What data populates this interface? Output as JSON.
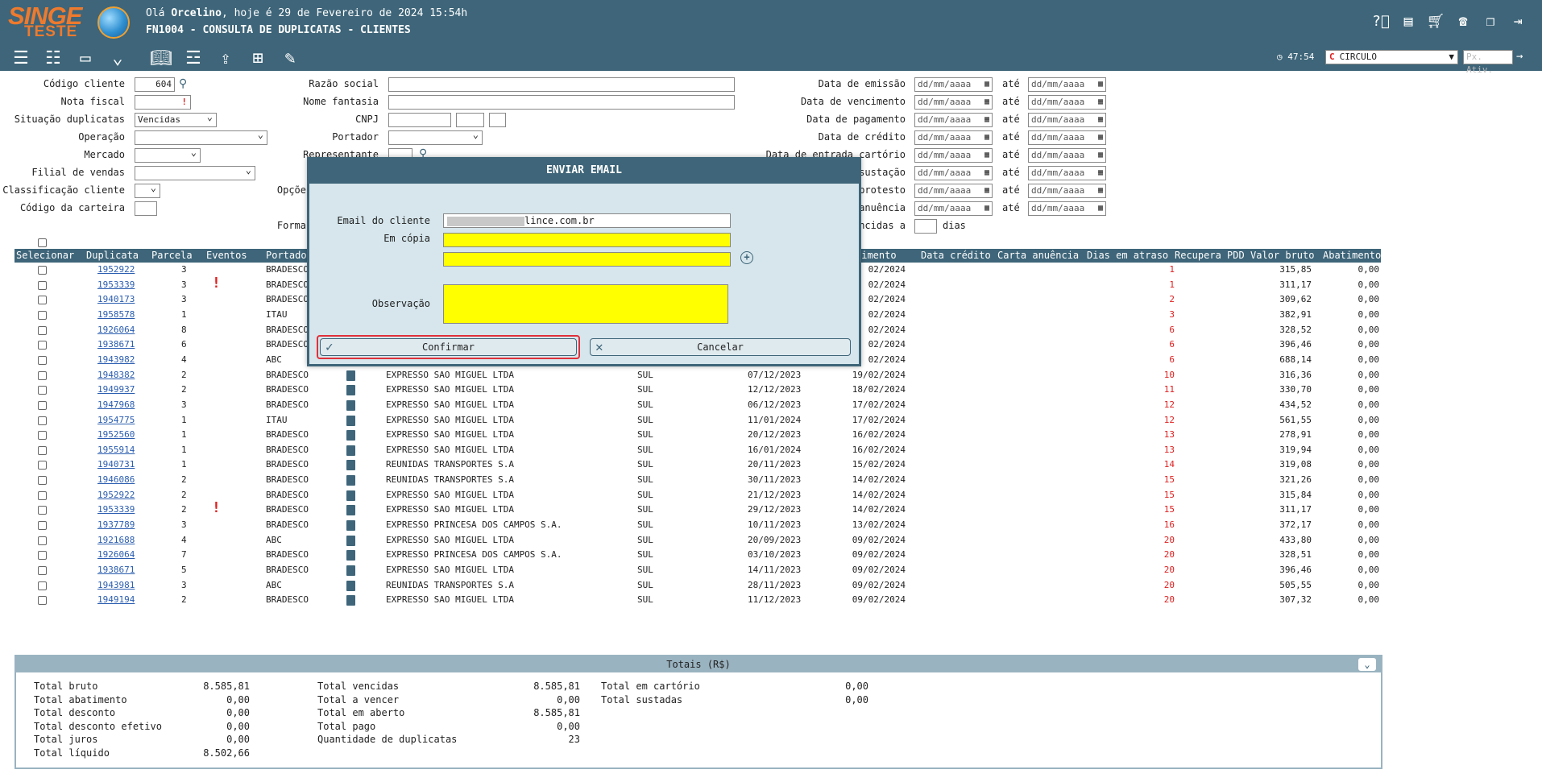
{
  "header": {
    "logo_top": "SINGE",
    "logo_bottom": "TESTE",
    "greeting_prefix": "Olá ",
    "greeting_user": "Orcelino",
    "greeting_suffix": ", hoje é 29 de Fevereiro de 2024 15:54h",
    "screen_title": "FN1004 - CONSULTA DE DUPLICATAS - CLIENTES",
    "icons": [
      "help-icon",
      "document-icon",
      "cart-icon",
      "phone-icon",
      "windows-icon",
      "logout-icon"
    ]
  },
  "toolbar": {
    "icons": [
      "list-icon",
      "checklist-icon",
      "card-list-icon",
      "expand-icon",
      "book-icon",
      "sliders-icon",
      "upload-icon",
      "grid-icon",
      "edit-document-icon"
    ],
    "timer": "47:54",
    "company": "CIRCULO",
    "px_ativ_placeholder": "Px. Ativ."
  },
  "filters": {
    "codigo_cliente_label": "Código cliente",
    "codigo_cliente_value": "604",
    "nota_fiscal_label": "Nota fiscal",
    "situacao_label": "Situação duplicatas",
    "situacao_value": "Vencidas",
    "operacao_label": "Operação",
    "mercado_label": "Mercado",
    "filial_label": "Filial de vendas",
    "classificacao_label": "Classificação cliente",
    "carteira_label": "Código da carteira",
    "razao_label": "Razão social",
    "fantasia_label": "Nome fantasia",
    "cnpj_label": "CNPJ",
    "portador_label": "Portador",
    "representante_label": "Representante",
    "opcoes_label": "Opçõe",
    "forma_label": "Forma",
    "emissao_label": "Data de emissão",
    "vencimento_label": "Data de vencimento",
    "pagamento_label": "Data de pagamento",
    "credito_label": "Data de crédito",
    "cartorio_label": "Data de entrada cartório",
    "sustacao_label": "sustação",
    "protesto_label": "protesto",
    "anuencia_label": "anuência",
    "vencidas_a_label": "ncidas a",
    "dias_label": "dias",
    "date_placeholder": "dd/mm/aaaa",
    "ate": "até"
  },
  "table": {
    "headers": [
      "Selecionar",
      "Duplicata",
      "Parcela",
      "Eventos",
      "Portado",
      "cimento",
      "Data crédito",
      "Carta anuência",
      "Dias em atraso",
      "Recupera PDD",
      "Valor bruto",
      "Abatimento"
    ],
    "rows": [
      {
        "dup": "1952922",
        "parc": "3",
        "ev": false,
        "port": "BRADESCO",
        "doc": false,
        "razao": "",
        "reg": "",
        "emis": "",
        "venc": "02/2024",
        "dias": "1",
        "bruto": "315,85",
        "abat": "0,00"
      },
      {
        "dup": "1953339",
        "parc": "3",
        "ev": true,
        "port": "BRADESCO",
        "doc": false,
        "razao": "",
        "reg": "",
        "emis": "",
        "venc": "02/2024",
        "dias": "1",
        "bruto": "311,17",
        "abat": "0,00"
      },
      {
        "dup": "1940173",
        "parc": "3",
        "ev": false,
        "port": "BRADESCO",
        "doc": false,
        "razao": "",
        "reg": "",
        "emis": "",
        "venc": "02/2024",
        "dias": "2",
        "bruto": "309,62",
        "abat": "0,00"
      },
      {
        "dup": "1958578",
        "parc": "1",
        "ev": false,
        "port": "ITAU",
        "doc": false,
        "razao": "",
        "reg": "",
        "emis": "",
        "venc": "02/2024",
        "dias": "3",
        "bruto": "382,91",
        "abat": "0,00"
      },
      {
        "dup": "1926064",
        "parc": "8",
        "ev": false,
        "port": "BRADESCO",
        "doc": false,
        "razao": "",
        "reg": "",
        "emis": "",
        "venc": "02/2024",
        "dias": "6",
        "bruto": "328,52",
        "abat": "0,00"
      },
      {
        "dup": "1938671",
        "parc": "6",
        "ev": false,
        "port": "BRADESCO",
        "doc": false,
        "razao": "",
        "reg": "",
        "emis": "",
        "venc": "02/2024",
        "dias": "6",
        "bruto": "396,46",
        "abat": "0,00"
      },
      {
        "dup": "1943982",
        "parc": "4",
        "ev": false,
        "port": "ABC",
        "doc": false,
        "razao": "",
        "reg": "",
        "emis": "",
        "venc": "02/2024",
        "dias": "6",
        "bruto": "688,14",
        "abat": "0,00"
      },
      {
        "dup": "1948382",
        "parc": "2",
        "ev": false,
        "port": "BRADESCO",
        "doc": true,
        "razao": "EXPRESSO SAO MIGUEL LTDA",
        "reg": "SUL",
        "emis": "07/12/2023",
        "venc": "19/02/2024",
        "dias": "10",
        "bruto": "316,36",
        "abat": "0,00"
      },
      {
        "dup": "1949937",
        "parc": "2",
        "ev": false,
        "port": "BRADESCO",
        "doc": true,
        "razao": "EXPRESSO SAO MIGUEL LTDA",
        "reg": "SUL",
        "emis": "12/12/2023",
        "venc": "18/02/2024",
        "dias": "11",
        "bruto": "330,70",
        "abat": "0,00"
      },
      {
        "dup": "1947968",
        "parc": "3",
        "ev": false,
        "port": "BRADESCO",
        "doc": true,
        "razao": "EXPRESSO SAO MIGUEL LTDA",
        "reg": "SUL",
        "emis": "06/12/2023",
        "venc": "17/02/2024",
        "dias": "12",
        "bruto": "434,52",
        "abat": "0,00"
      },
      {
        "dup": "1954775",
        "parc": "1",
        "ev": false,
        "port": "ITAU",
        "doc": true,
        "razao": "EXPRESSO SAO MIGUEL LTDA",
        "reg": "SUL",
        "emis": "11/01/2024",
        "venc": "17/02/2024",
        "dias": "12",
        "bruto": "561,55",
        "abat": "0,00"
      },
      {
        "dup": "1952560",
        "parc": "1",
        "ev": false,
        "port": "BRADESCO",
        "doc": true,
        "razao": "EXPRESSO SAO MIGUEL LTDA",
        "reg": "SUL",
        "emis": "20/12/2023",
        "venc": "16/02/2024",
        "dias": "13",
        "bruto": "278,91",
        "abat": "0,00"
      },
      {
        "dup": "1955914",
        "parc": "1",
        "ev": false,
        "port": "BRADESCO",
        "doc": true,
        "razao": "EXPRESSO SAO MIGUEL LTDA",
        "reg": "SUL",
        "emis": "16/01/2024",
        "venc": "16/02/2024",
        "dias": "13",
        "bruto": "319,94",
        "abat": "0,00"
      },
      {
        "dup": "1940731",
        "parc": "1",
        "ev": false,
        "port": "BRADESCO",
        "doc": true,
        "razao": "REUNIDAS TRANSPORTES S.A",
        "reg": "SUL",
        "emis": "20/11/2023",
        "venc": "15/02/2024",
        "dias": "14",
        "bruto": "319,08",
        "abat": "0,00"
      },
      {
        "dup": "1946086",
        "parc": "2",
        "ev": false,
        "port": "BRADESCO",
        "doc": true,
        "razao": "REUNIDAS TRANSPORTES S.A",
        "reg": "SUL",
        "emis": "30/11/2023",
        "venc": "14/02/2024",
        "dias": "15",
        "bruto": "321,26",
        "abat": "0,00"
      },
      {
        "dup": "1952922",
        "parc": "2",
        "ev": false,
        "port": "BRADESCO",
        "doc": true,
        "razao": "EXPRESSO SAO MIGUEL LTDA",
        "reg": "SUL",
        "emis": "21/12/2023",
        "venc": "14/02/2024",
        "dias": "15",
        "bruto": "315,84",
        "abat": "0,00"
      },
      {
        "dup": "1953339",
        "parc": "2",
        "ev": true,
        "port": "BRADESCO",
        "doc": true,
        "razao": "EXPRESSO SAO MIGUEL LTDA",
        "reg": "SUL",
        "emis": "29/12/2023",
        "venc": "14/02/2024",
        "dias": "15",
        "bruto": "311,17",
        "abat": "0,00"
      },
      {
        "dup": "1937789",
        "parc": "3",
        "ev": false,
        "port": "BRADESCO",
        "doc": true,
        "razao": "EXPRESSO PRINCESA DOS CAMPOS S.A.",
        "reg": "SUL",
        "emis": "10/11/2023",
        "venc": "13/02/2024",
        "dias": "16",
        "bruto": "372,17",
        "abat": "0,00"
      },
      {
        "dup": "1921688",
        "parc": "4",
        "ev": false,
        "port": "ABC",
        "doc": true,
        "razao": "EXPRESSO SAO MIGUEL LTDA",
        "reg": "SUL",
        "emis": "20/09/2023",
        "venc": "09/02/2024",
        "dias": "20",
        "bruto": "433,80",
        "abat": "0,00"
      },
      {
        "dup": "1926064",
        "parc": "7",
        "ev": false,
        "port": "BRADESCO",
        "doc": true,
        "razao": "EXPRESSO PRINCESA DOS CAMPOS S.A.",
        "reg": "SUL",
        "emis": "03/10/2023",
        "venc": "09/02/2024",
        "dias": "20",
        "bruto": "328,51",
        "abat": "0,00"
      },
      {
        "dup": "1938671",
        "parc": "5",
        "ev": false,
        "port": "BRADESCO",
        "doc": true,
        "razao": "EXPRESSO SAO MIGUEL LTDA",
        "reg": "SUL",
        "emis": "14/11/2023",
        "venc": "09/02/2024",
        "dias": "20",
        "bruto": "396,46",
        "abat": "0,00"
      },
      {
        "dup": "1943981",
        "parc": "3",
        "ev": false,
        "port": "ABC",
        "doc": true,
        "razao": "REUNIDAS TRANSPORTES S.A",
        "reg": "SUL",
        "emis": "28/11/2023",
        "venc": "09/02/2024",
        "dias": "20",
        "bruto": "505,55",
        "abat": "0,00"
      },
      {
        "dup": "1949194",
        "parc": "2",
        "ev": false,
        "port": "BRADESCO",
        "doc": true,
        "razao": "EXPRESSO SAO MIGUEL LTDA",
        "reg": "SUL",
        "emis": "11/12/2023",
        "venc": "09/02/2024",
        "dias": "20",
        "bruto": "307,32",
        "abat": "0,00"
      }
    ]
  },
  "totals": {
    "title": "Totais (R$)",
    "col1": [
      [
        "Total bruto",
        "8.585,81"
      ],
      [
        "Total abatimento",
        "0,00"
      ],
      [
        "Total desconto",
        "0,00"
      ],
      [
        "Total desconto efetivo",
        "0,00"
      ],
      [
        "Total juros",
        "0,00"
      ],
      [
        "Total líquido",
        "8.502,66"
      ]
    ],
    "col2": [
      [
        "Total vencidas",
        "8.585,81"
      ],
      [
        "Total a vencer",
        "0,00"
      ],
      [
        "Total em aberto",
        "8.585,81"
      ],
      [
        "Total pago",
        "0,00"
      ],
      [
        "Quantidade de duplicatas",
        "23"
      ]
    ],
    "col3": [
      [
        "Total em cartório",
        "0,00"
      ],
      [
        "Total sustadas",
        "0,00"
      ]
    ]
  },
  "modal": {
    "title": "ENVIAR EMAIL",
    "email_label": "Email do cliente",
    "email_value": "lince.com.br",
    "copy_label": "Em cópia",
    "obs_label": "Observação",
    "confirm_label": "Confirmar",
    "cancel_label": "Cancelar"
  },
  "colors": {
    "header": "#3e6579",
    "accent": "#ee7a2e",
    "overdue": "#e02020",
    "highlight": "#ffff00"
  }
}
